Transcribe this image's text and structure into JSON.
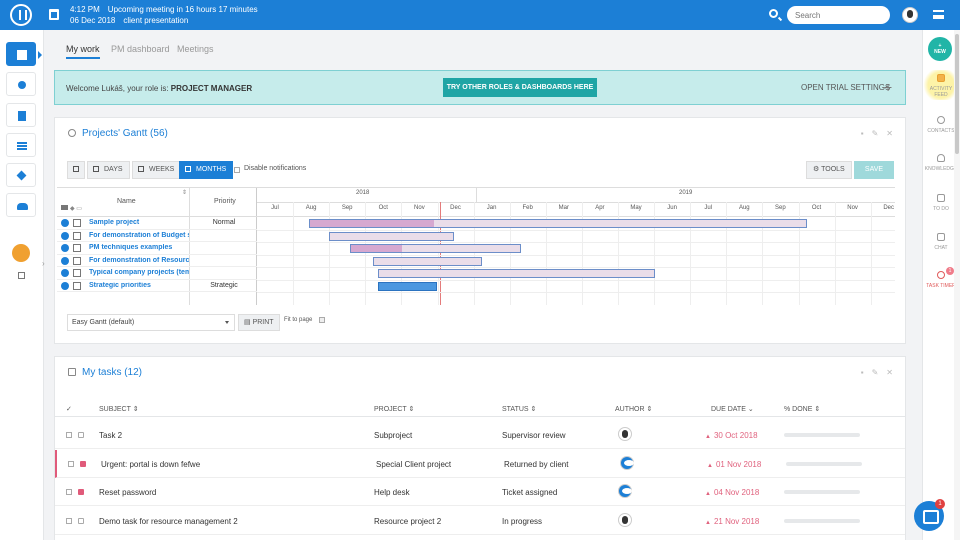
{
  "topbar": {
    "time": "4:12 PM",
    "meeting_text": "Upcoming meeting in 16 hours 17 minutes",
    "date": "06 Dec 2018",
    "meeting_name": "client presentation",
    "search_placeholder": "Search"
  },
  "tabs": [
    "My work",
    "PM dashboard",
    "Meetings"
  ],
  "welcome": {
    "text": "Welcome Lukáš, your role is:",
    "role": "PROJECT MANAGER",
    "try_button": "TRY OTHER ROLES & DASHBOARDS HERE",
    "trial": "OPEN TRIAL SETTINGS"
  },
  "gantt": {
    "title": "Projects' Gantt (56)",
    "buttons": [
      "DAYS",
      "WEEKS",
      "MONTHS"
    ],
    "active_button": "MONTHS",
    "disable_notifications": "Disable notifications",
    "tools": "TOOLS",
    "save": "SAVE",
    "col_name": "Name",
    "col_priority": "Priority",
    "years": [
      "2018",
      "2019"
    ],
    "months": [
      "Jul",
      "Aug",
      "Sep",
      "Oct",
      "Nov",
      "Dec",
      "Jan",
      "Feb",
      "Mar",
      "Apr",
      "May",
      "Jun",
      "Jul",
      "Aug",
      "Sep",
      "Oct",
      "Nov",
      "Dec"
    ],
    "projects": [
      {
        "name": "Sample project",
        "priority": "Normal",
        "start": "2018-08-15",
        "end": "2019-10-08",
        "done": 0.25
      },
      {
        "name": "For demonstration of Budget st",
        "priority": "",
        "start": "2018-09-01",
        "end": "2018-12-15",
        "done": 0
      },
      {
        "name": "PM techniques examples",
        "priority": "",
        "start": "2018-09-18",
        "end": "2019-02-10",
        "done": 0.3
      },
      {
        "name": "For demonstration of Resource",
        "priority": "",
        "start": "2018-10-08",
        "end": "2019-01-08",
        "done": 0
      },
      {
        "name": "Typical company projects (temp",
        "priority": "",
        "start": "2018-10-12",
        "end": "2019-06-02",
        "done": 0
      },
      {
        "name": "Strategic priorities",
        "priority": "Strategic",
        "start": "2018-10-12",
        "end": "2018-12-01",
        "done": 1
      }
    ],
    "layout_select": "Easy Gantt (default)",
    "print": "PRINT",
    "fit_to_page": "Fit to page"
  },
  "tasks": {
    "title": "My tasks (12)",
    "columns": [
      "SUBJECT",
      "PROJECT",
      "STATUS",
      "AUTHOR",
      "DUE DATE",
      "% DONE"
    ],
    "rows": [
      {
        "subject": "Task 2",
        "project": "Subproject",
        "status": "Supervisor review",
        "due": "30 Oct 2018",
        "author": "photo",
        "done": 0,
        "urgent": false
      },
      {
        "subject": "Urgent: portal is down fefwe",
        "project": "Special Client project",
        "status": "Returned by client",
        "due": "01 Nov 2018",
        "author": "logo",
        "done": 0,
        "urgent": true
      },
      {
        "subject": "Reset password",
        "project": "Help desk",
        "status": "Ticket assigned",
        "due": "04 Nov 2018",
        "author": "logo",
        "done": 0,
        "urgent": false
      },
      {
        "subject": "Demo task for resource management 2",
        "project": "Resource project 2",
        "status": "In progress",
        "due": "21 Nov 2018",
        "author": "photo",
        "done": 0,
        "urgent": false
      }
    ]
  },
  "rightbar": {
    "new": "NEW",
    "items": [
      "ACTIVITY FEED",
      "CONTACTS",
      "KNOWLEDGE",
      "TO DO",
      "CHAT",
      "TASK TIMER"
    ],
    "timer_badge": "1"
  },
  "chat_badge": "1"
}
